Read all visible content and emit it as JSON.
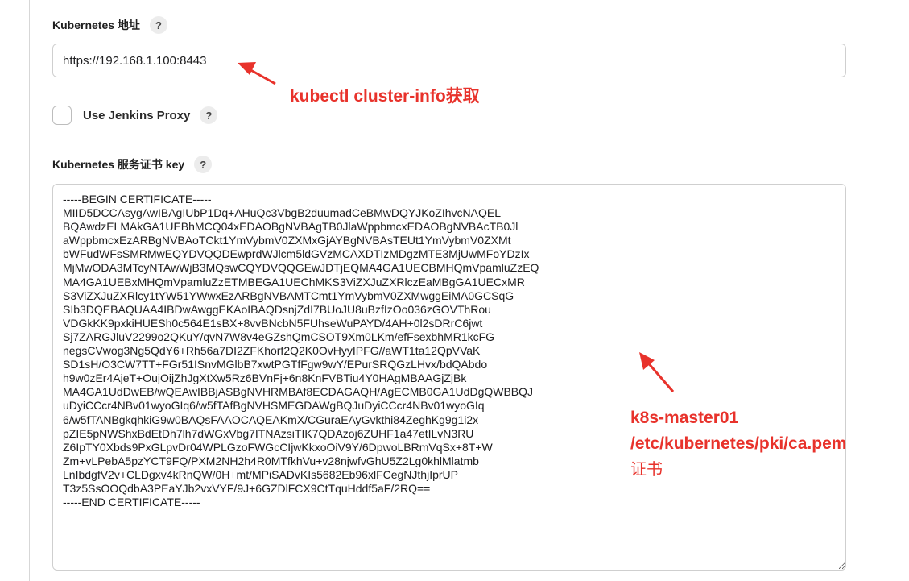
{
  "kubernetes_url": {
    "label": "Kubernetes 地址",
    "help": "?",
    "value": "https://192.168.1.100:8443"
  },
  "proxy": {
    "label": "Use Jenkins Proxy",
    "help": "?",
    "checked": false
  },
  "certificate": {
    "label": "Kubernetes 服务证书 key",
    "help": "?",
    "value": "-----BEGIN CERTIFICATE-----\nMIID5DCCAsygAwIBAgIUbP1Dq+AHuQc3VbgB2duumadCeBMwDQYJKoZIhvcNAQEL\nBQAwdzELMAkGA1UEBhMCQ04xEDAOBgNVBAgTB0JlaWppbmcxEDAOBgNVBAcTB0Jl\naWppbmcxEzARBgNVBAoTCkt1YmVybmV0ZXMxGjAYBgNVBAsTEUt1YmVybmV0ZXMt\nbWFudWFsSMRMwEQYDVQQDEwprdWJlcm5ldGVzMCAXDTIzMDgzMTE3MjUwMFoYDzIx\nMjMwODA3MTcyNTAwWjB3MQswCQYDVQQGEwJDTjEQMA4GA1UECBMHQmVpamluZzEQ\nMA4GA1UEBxMHQmVpamluZzETMBEGA1UEChMKS3ViZXJuZXRlczEaMBgGA1UECxMR\nS3ViZXJuZXRlcy1tYW51YWwxEzARBgNVBAMTCmt1YmVybmV0ZXMwggEiMA0GCSqG\nSIb3DQEBAQUAA4IBDwAwggEKAoIBAQDsnjZdI7BUoJU8uBzfIzOo036zGOVThRou\nVDGkKK9pxkiHUESh0c564E1sBX+8vvBNcbN5FUhseWuPAYD/4AH+0l2sDRrC6jwt\nSj7ZARGJluV2299o2QKuY/qvN7W8v4eGZshQmCSOT9Xm0LKm/efFsexbhMR1kcFG\nnegsCVwog3Ng5QdY6+Rh56a7DI2ZFKhorf2Q2K0OvHyyIPFG//aWT1ta12QpVVaK\nSD1sH/O3CW7TT+FGr51ISnvMGlbB7xwtPGTfFgw9wY/EPurSRQGzLHvx/bdQAbdo\nh9w0zEr4AjeT+OujOijZhJgXtXw5Rz6BVnFj+6n8KnFVBTiu4Y0HAgMBAAGjZjBk\nMA4GA1UdDwEB/wQEAwIBBjASBgNVHRMBAf8ECDAGAQH/AgECMB0GA1UdDgQWBBQJ\nuDyiCCcr4NBv01wyoGIq6/w5fTAfBgNVHSMEGDAWgBQJuDyiCCcr4NBv01wyoGIq\n6/w5fTANBgkqhkiG9w0BAQsFAAOCAQEAKmX/CGuraEAyGvkthi84ZeghKg9g1i2x\npZIE5pNWShxBdEtDh7lh7dWGxVbg7ITNAzsiTIK7QDAzoj6ZUHF1a47etILvN3RU\nZ6IpTY0Xbds9PxGLpvDr04WPLGzoFWGcCIjwKkxoOiV9Y/6DpwoLBRmVqSx+8T+W\nZm+vLPebA5pzYCT9FQ/PXM2NH2h4R0MTfkhVu+v28njwfvGhU5Z2Lg0khlMlatmb\nLnIbdgfV2v+CLDgxv4kRnQW/0H+mt/MPiSADvKIs5682Eb96xlFCegNJthjIprUP\nT3z5SsOOQdbA3PEaYJb2vxVYF/9J+6GZDlFCX9CtTquHddf5aF/2RQ==\n-----END CERTIFICATE-----"
  },
  "annotations": {
    "url_note": "kubectl cluster-info获取",
    "cert_note_line1": "k8s-master01",
    "cert_note_line2": "/etc/kubernetes/pki/ca.pem",
    "cert_note_line3": "证书",
    "color": "#e8322b"
  }
}
